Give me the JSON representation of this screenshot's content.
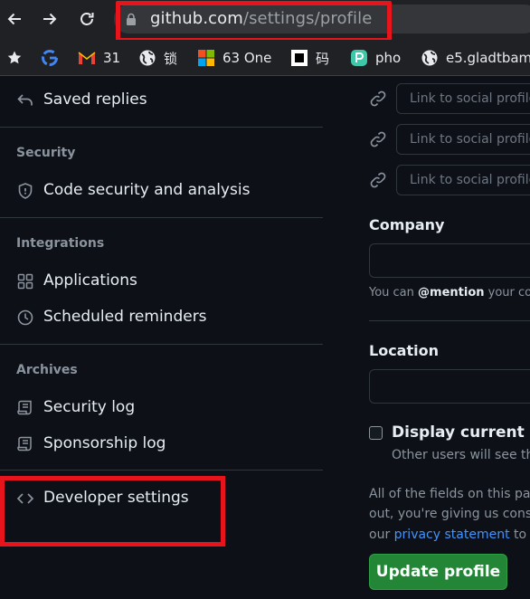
{
  "browser": {
    "url_host": "github.com",
    "url_path": "/settings/profile",
    "bookmarks": [
      {
        "label": "",
        "icon": "star-icon"
      },
      {
        "label": "",
        "icon": "google-icon"
      },
      {
        "label": "31",
        "icon": "gmail-icon"
      },
      {
        "label": "锁",
        "icon": "globe-icon"
      },
      {
        "label": "63 One",
        "icon": "microsoft-icon"
      },
      {
        "label": "码",
        "icon": "square-icon"
      },
      {
        "label": "pho",
        "icon": "p-icon"
      },
      {
        "label": "e5.gladtbam",
        "icon": "globe-icon"
      }
    ]
  },
  "sidebar": {
    "saved_replies": "Saved replies",
    "security_heading": "Security",
    "code_security": "Code security and analysis",
    "integrations_heading": "Integrations",
    "applications": "Applications",
    "scheduled_reminders": "Scheduled reminders",
    "archives_heading": "Archives",
    "security_log": "Security log",
    "sponsorship_log": "Sponsorship log",
    "developer_settings": "Developer settings"
  },
  "profile": {
    "social_placeholder": "Link to social profile",
    "company_label": "Company",
    "company_value": "",
    "company_note_prefix": "You can ",
    "company_note_mention": "@mention",
    "company_note_suffix": " your co",
    "location_label": "Location",
    "location_value": "",
    "display_time_label": "Display current loc",
    "display_time_help": "Other users will see the",
    "privacy_line1": "All of the fields on this pag",
    "privacy_line2": "out, you're giving us consen",
    "privacy_line3_prefix": "our ",
    "privacy_link": "privacy statement",
    "privacy_line3_suffix": " to le",
    "update_button": "Update profile"
  },
  "colors": {
    "accent_green": "#238636",
    "link_blue": "#4493f8",
    "highlight_red": "#e8141b",
    "background": "#0d1117"
  }
}
